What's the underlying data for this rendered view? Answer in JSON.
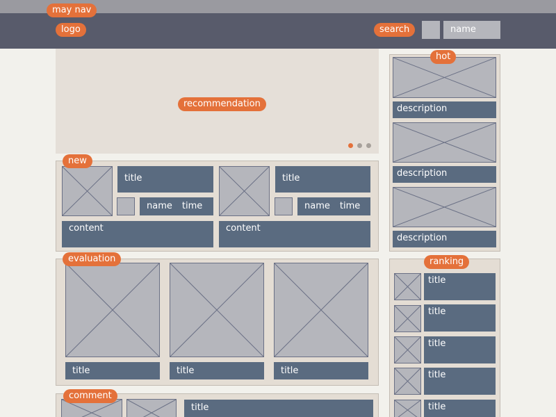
{
  "nav": {
    "label": "may nav"
  },
  "header": {
    "logo": "logo",
    "search": "search",
    "name": "name"
  },
  "recommendation": {
    "label": "recommendation",
    "slides": 3,
    "active_slide": 1
  },
  "new_section": {
    "label": "new",
    "items": [
      {
        "title": "title",
        "name": "name",
        "time": "time",
        "content": "content"
      },
      {
        "title": "title",
        "name": "name",
        "time": "time",
        "content": "content"
      }
    ]
  },
  "evaluation": {
    "label": "evaluation",
    "items": [
      {
        "title": "title"
      },
      {
        "title": "title"
      },
      {
        "title": "title"
      }
    ]
  },
  "comment": {
    "label": "comment",
    "title": "title"
  },
  "hot": {
    "label": "hot",
    "items": [
      {
        "description": "description"
      },
      {
        "description": "description"
      },
      {
        "description": "description"
      }
    ]
  },
  "ranking": {
    "label": "ranking",
    "items": [
      {
        "title": "title"
      },
      {
        "title": "title"
      },
      {
        "title": "title"
      },
      {
        "title": "title"
      },
      {
        "title": "title"
      }
    ]
  },
  "colors": {
    "accent": "#e4713a",
    "header": "#585b6b",
    "block": "#5a6b80",
    "placeholder": "#b5b6bc",
    "panel": "#e4ddd4"
  }
}
